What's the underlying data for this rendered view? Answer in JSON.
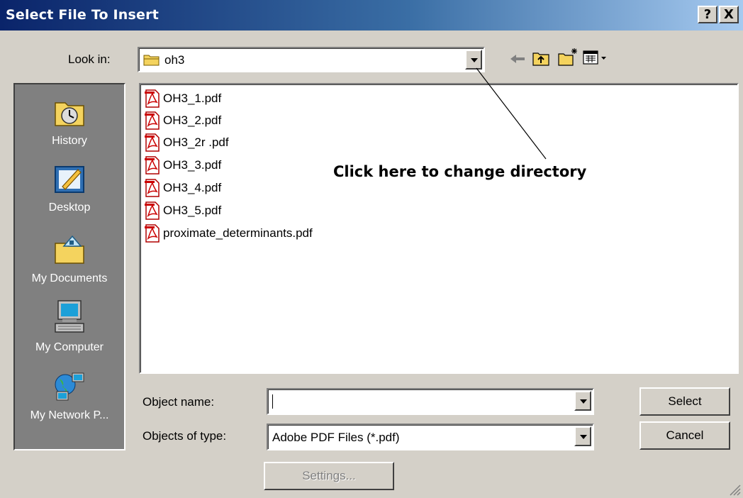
{
  "window": {
    "title": "Select File To Insert",
    "help_label": "?",
    "close_label": "X"
  },
  "lookin": {
    "label": "Look in:",
    "value": "oh3"
  },
  "places": [
    {
      "label": "History",
      "icon": "history-icon"
    },
    {
      "label": "Desktop",
      "icon": "desktop-icon"
    },
    {
      "label": "My Documents",
      "icon": "my-documents-icon"
    },
    {
      "label": "My Computer",
      "icon": "my-computer-icon"
    },
    {
      "label": "My Network P...",
      "icon": "my-network-places-icon"
    }
  ],
  "files": [
    {
      "name": "OH3_1.pdf"
    },
    {
      "name": "OH3_2.pdf"
    },
    {
      "name": "OH3_2r .pdf"
    },
    {
      "name": "OH3_3.pdf"
    },
    {
      "name": "OH3_4.pdf"
    },
    {
      "name": "OH3_5.pdf"
    },
    {
      "name": "proximate_determinants.pdf"
    }
  ],
  "annotation": "Click here to change directory",
  "object_name": {
    "label": "Object name:",
    "value": ""
  },
  "object_type": {
    "label": "Objects of type:",
    "value": "Adobe PDF Files (*.pdf)"
  },
  "buttons": {
    "select": "Select",
    "cancel": "Cancel",
    "settings": "Settings..."
  },
  "colors": {
    "title_start": "#0a246a",
    "title_end": "#a6caf0",
    "dialog_bg": "#d4d0c8",
    "places_bg": "#808080",
    "pdf_red": "#cc0000"
  }
}
